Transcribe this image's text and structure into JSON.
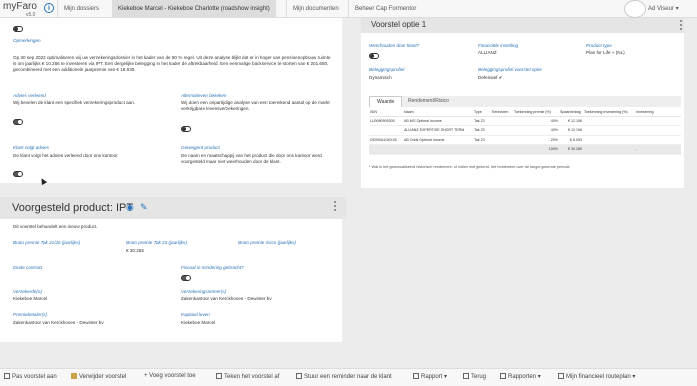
{
  "topbar": {
    "brand": "myFaro",
    "version": "v5.0",
    "brand_icon": "info-icon",
    "tabs": [
      {
        "label": "Mijn dossiers",
        "active": false
      },
      {
        "label": "Kiekeboe Marcel - Kiekeboe Charlotte (roadshow insight)",
        "active": true
      },
      {
        "label": "Mijn documenten",
        "active": false
      },
      {
        "label": "Beheer Cap Formentor",
        "active": false
      }
    ],
    "user": "Ad Viseur",
    "user_chevron": "▾"
  },
  "left": {
    "opmerkingen_label": "Opmerkingen",
    "opmerkingen_text": "Op 30 sep 2022 optimaliseren wij uw verzekeringsdossier in het kader van de 80 % regel. Uit deze analyse blijkt dat er in hoger van pensioenopbouw ruimte is om jaarlijks € 10.266 te investeren via IPT. Een dergelijke belegging in het kader de aftrekbaarheid. Een eenmalige backservice te storten van € 201.650, gecombineerd met een additionele jaarpremie van € 18.630.",
    "advies_label": "Advies verleend",
    "advies_text": "Wij bevelen de klant een specifiek verzekeringsproduct aan.",
    "alternatieven_label": "Alternatieven bekeken",
    "alternatieven_text": "Wij doen een onpartijdige analyse van een toereikend aantal op de markt verkrijgbare levensverzekeringen.",
    "klant_label": "Klant volgt advies",
    "klant_text": "De klant volgt het advies verleend door ons kantoor",
    "geweigerd_label": "Geweigerd product",
    "geweigerd_text": "De naam en maatschappij van het product die door ons kantoor werd voorgesteld maar niet weerhouden door de klant."
  },
  "product": {
    "title": "Voorgesteld product: IPT",
    "eye_icon": "eye-icon",
    "edit_icon": "edit-icon",
    "subtitle": "Dit voorstel behandelt een nieuw product.",
    "bruto_2128_label": "Bruto premie Tak 21/26 (jaarlijks)",
    "bruto_23_label": "Bruto premie Tak 23 (jaarlijks)",
    "bruto_23_value": "€ 30.265",
    "bruto_risico_label": "Bruto premie risico (jaarlijks)",
    "einde_label": "Einde contract",
    "fiscaal_label": "Fiscaal in mindering gebracht?",
    "verzekerde_label": "Verzekerde(n)",
    "verzekerde_value": "Kiekeboe Marcel",
    "verzekeringsnemer_label": "Verzekeringsnemer(s)",
    "verzekeringsnemer_value": "Zakenkantoor van Kerckhoven - Dewinter bv",
    "premiebetaler_label": "Premiebetaler(s)",
    "premiebetaler_value": "Zakenkantoor van Kerckhoven - Dewinter bv",
    "kapitaal_label": "Kapitaal leven",
    "kapitaal_value": "Kiekeboe Marcel"
  },
  "right": {
    "title": "Voorstel optie 1",
    "weerhouden_label": "Weerhouden door klant?",
    "instelling_label": "Financiële instelling",
    "instelling_value": "ALLIANZ",
    "producttype_label": "Product type",
    "producttype_value": "Plan for Life + (NL)",
    "profiel_label": "Beleggingsprofiel",
    "profiel_value": "Dynamisch",
    "profiel_voorstel_label": "Beleggingsprofiel voorstel optie",
    "profiel_voorstel_value": "Defensief ✔",
    "tabs": [
      {
        "label": "Waarde",
        "active": true
      },
      {
        "label": "Rendement/Risico",
        "active": false
      }
    ],
    "table": {
      "headers": [
        "ISIN",
        "Naam",
        "Type",
        "Eenheden",
        "Toekenning premie (%)",
        "Spaarbedrag",
        "Toekenning Investering (%)",
        "Investering"
      ],
      "rows": [
        [
          "LU0080909305",
          "AB MG Optimal Income",
          "Tak 23",
          "",
          "40%",
          "€ 12.106",
          "",
          ""
        ],
        [
          "",
          "ALLIANZ EXPERTISE SHORT TERM",
          "Tak 23",
          "",
          "40%",
          "€ 12.106",
          "",
          ""
        ],
        [
          "DE000A1G6X45",
          "AB Odds Optimal Income",
          "Tak 23",
          "",
          "20%",
          "€ 6.053",
          "",
          ""
        ],
        [
          "",
          "",
          "",
          "",
          "100%",
          "€ 30.265",
          "",
          "-"
        ]
      ]
    },
    "footnote": "* Wat is het geannualiseerd historisch rendement: of indien niet gekend, het rendement over de langst gekende periode."
  },
  "bottombar": {
    "items": [
      {
        "label": "Pas voorstel aan",
        "icon": "edit-icon"
      },
      {
        "label": "Verwijder voorstel",
        "icon": "trash-icon"
      },
      {
        "label": "+ Voeg voorstel toe",
        "icon": ""
      },
      {
        "label": "Teken het voorstel af",
        "icon": "pen-icon"
      },
      {
        "label": "Stuur een reminder naar de klant",
        "icon": "send-icon"
      },
      {
        "label": "Rapport",
        "icon": "print-icon"
      },
      {
        "label": "Terug",
        "icon": "back-icon"
      },
      {
        "label": "Rapporten",
        "icon": "document-icon"
      },
      {
        "label": "Mijn financieel routeplan",
        "icon": "route-icon"
      }
    ],
    "dropdown": "▾"
  },
  "colors": {
    "accent": "#2a73b8",
    "panel": "#ffffff",
    "background": "#ececec"
  }
}
